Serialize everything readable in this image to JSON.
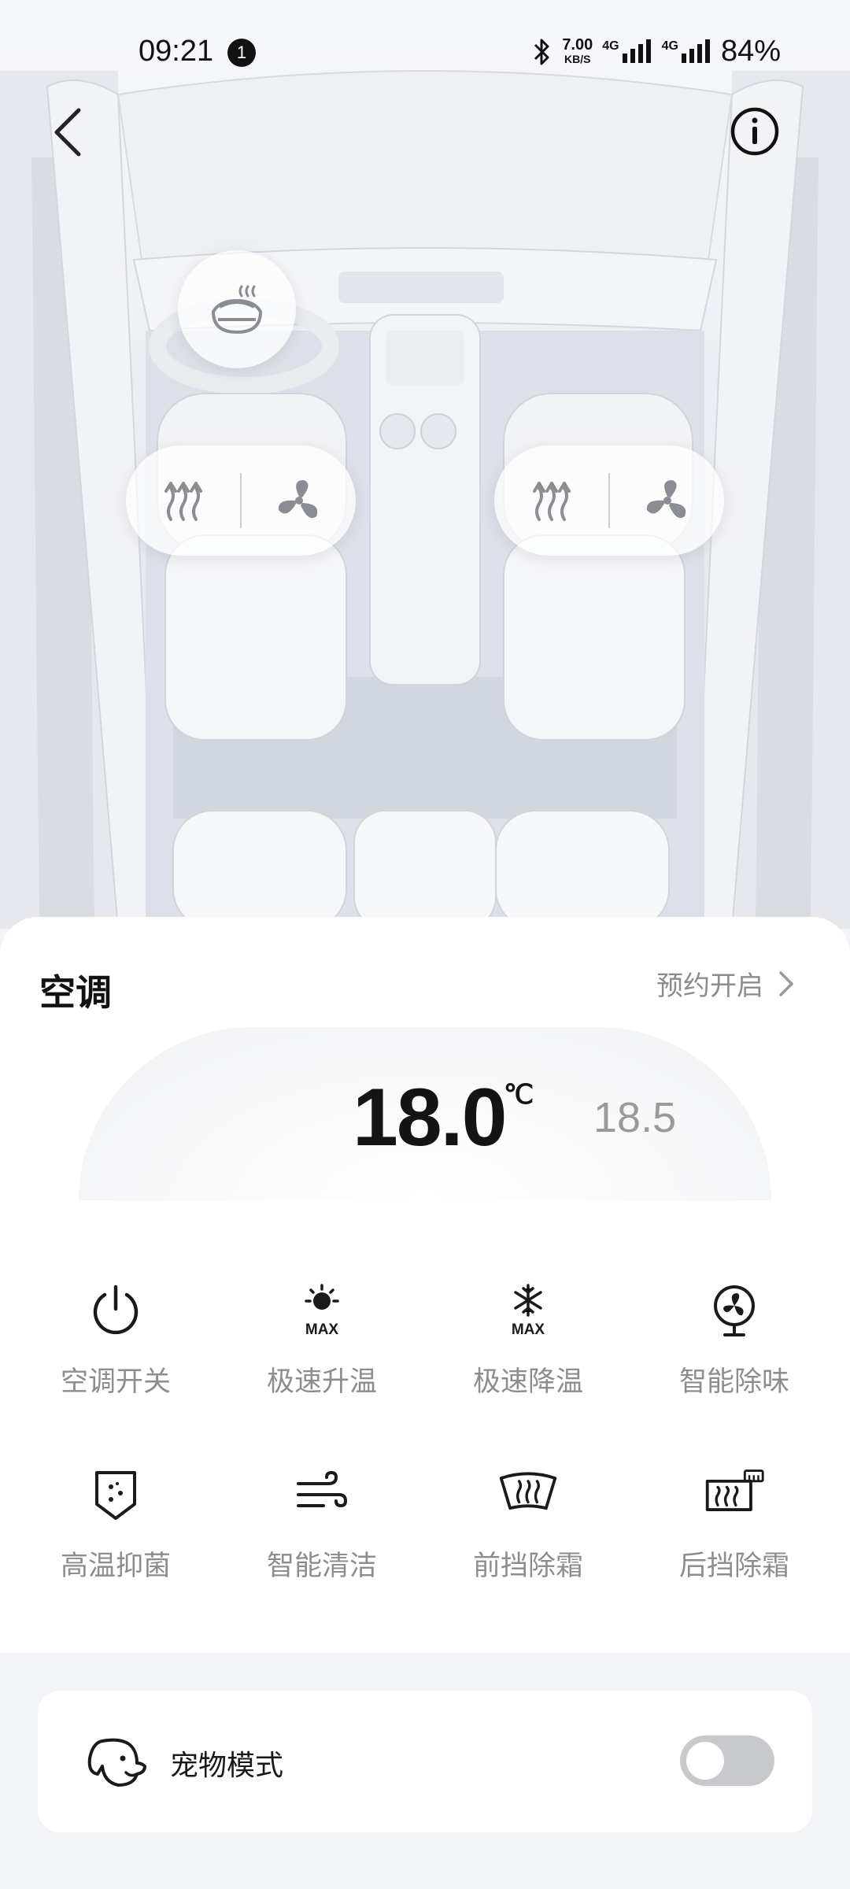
{
  "status_bar": {
    "time": "09:21",
    "notification_count": "1",
    "net_speed": "7.00",
    "net_unit": "KB/S",
    "signal_1": "4G",
    "signal_2": "4G",
    "battery": "84%"
  },
  "icons": {
    "back": "chevron-left-icon",
    "info": "info-icon",
    "steering_heat": "steering-wheel-heat-icon",
    "seat_heat": "seat-heat-icon",
    "seat_vent": "seat-ventilation-icon"
  },
  "ac": {
    "title": "空调",
    "schedule_label": "预约开启",
    "temperature": "18.0",
    "unit": "℃",
    "secondary_temperature": "18.5",
    "functions": [
      {
        "label": "空调开关",
        "icon": "power-icon"
      },
      {
        "label": "极速升温",
        "icon": "sun-max-icon"
      },
      {
        "label": "极速降温",
        "icon": "snowflake-max-icon"
      },
      {
        "label": "智能除味",
        "icon": "fan-purify-icon"
      },
      {
        "label": "高温抑菌",
        "icon": "shield-sterilize-icon"
      },
      {
        "label": "智能清洁",
        "icon": "wind-clean-icon"
      },
      {
        "label": "前挡除霜",
        "icon": "front-defrost-icon"
      },
      {
        "label": "后挡除霜",
        "icon": "rear-defrost-icon"
      }
    ]
  },
  "pet_mode": {
    "label": "宠物模式",
    "icon": "dog-icon",
    "enabled": false
  },
  "colors": {
    "text_primary": "#111111",
    "text_secondary": "#8d8d8d",
    "toggle_off": "#c8c9cc",
    "page_bg": "#f3f4f7"
  }
}
